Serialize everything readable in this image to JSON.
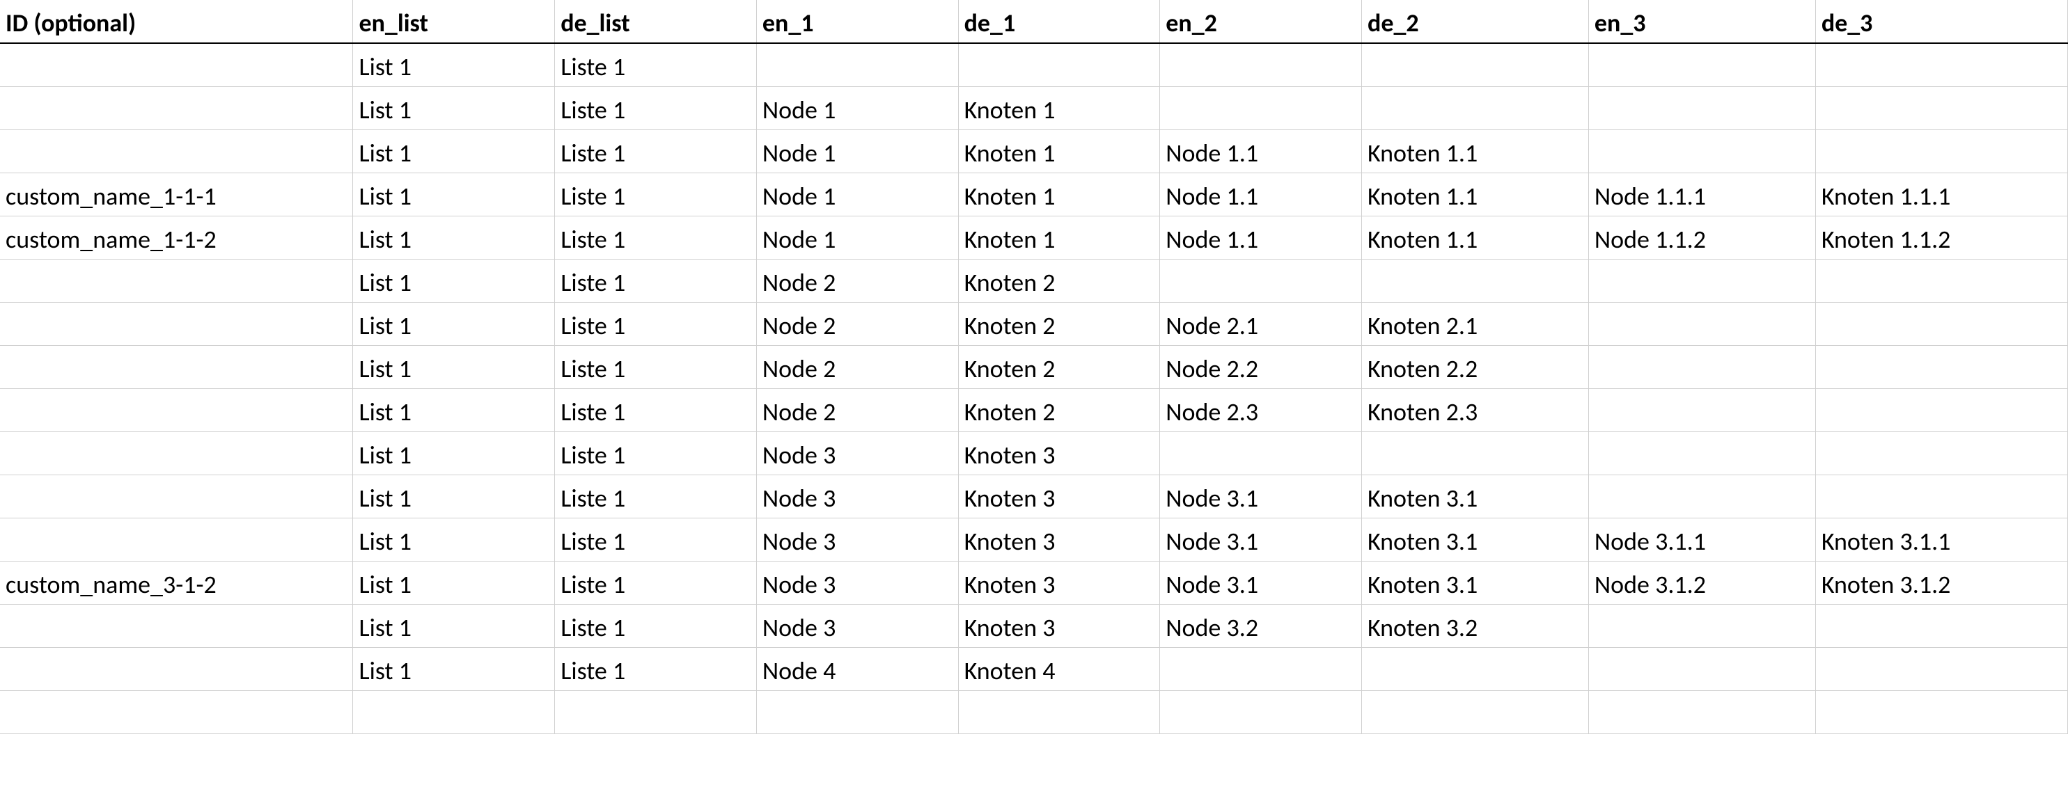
{
  "columns": [
    "ID (optional)",
    "en_list",
    "de_list",
    "en_1",
    "de_1",
    "en_2",
    "de_2",
    "en_3",
    "de_3"
  ],
  "rows": [
    [
      "",
      "List 1",
      "Liste 1",
      "",
      "",
      "",
      "",
      "",
      ""
    ],
    [
      "",
      "List 1",
      "Liste 1",
      "Node 1",
      "Knoten 1",
      "",
      "",
      "",
      ""
    ],
    [
      "",
      "List 1",
      "Liste 1",
      "Node 1",
      "Knoten 1",
      "Node 1.1",
      "Knoten 1.1",
      "",
      ""
    ],
    [
      "custom_name_1-1-1",
      "List 1",
      "Liste 1",
      "Node 1",
      "Knoten 1",
      "Node 1.1",
      "Knoten 1.1",
      "Node 1.1.1",
      "Knoten 1.1.1"
    ],
    [
      "custom_name_1-1-2",
      "List 1",
      "Liste 1",
      "Node 1",
      "Knoten 1",
      "Node 1.1",
      "Knoten 1.1",
      "Node 1.1.2",
      "Knoten 1.1.2"
    ],
    [
      "",
      "List 1",
      "Liste 1",
      "Node 2",
      "Knoten 2",
      "",
      "",
      "",
      ""
    ],
    [
      "",
      "List 1",
      "Liste 1",
      "Node 2",
      "Knoten 2",
      "Node 2.1",
      "Knoten 2.1",
      "",
      ""
    ],
    [
      "",
      "List 1",
      "Liste 1",
      "Node 2",
      "Knoten 2",
      "Node 2.2",
      "Knoten 2.2",
      "",
      ""
    ],
    [
      "",
      "List 1",
      "Liste 1",
      "Node 2",
      "Knoten 2",
      "Node 2.3",
      "Knoten 2.3",
      "",
      ""
    ],
    [
      "",
      "List 1",
      "Liste 1",
      "Node 3",
      "Knoten 3",
      "",
      "",
      "",
      ""
    ],
    [
      "",
      "List 1",
      "Liste 1",
      "Node 3",
      "Knoten 3",
      "Node 3.1",
      "Knoten 3.1",
      "",
      ""
    ],
    [
      "",
      "List 1",
      "Liste 1",
      "Node 3",
      "Knoten 3",
      "Node 3.1",
      "Knoten 3.1",
      "Node 3.1.1",
      "Knoten 3.1.1"
    ],
    [
      "custom_name_3-1-2",
      "List 1",
      "Liste 1",
      "Node 3",
      "Knoten 3",
      "Node 3.1",
      "Knoten 3.1",
      "Node 3.1.2",
      "Knoten 3.1.2"
    ],
    [
      "",
      "List 1",
      "Liste 1",
      "Node 3",
      "Knoten 3",
      "Node 3.2",
      "Knoten 3.2",
      "",
      ""
    ],
    [
      "",
      "List 1",
      "Liste 1",
      "Node 4",
      "Knoten 4",
      "",
      "",
      "",
      ""
    ],
    [
      "",
      "",
      "",
      "",
      "",
      "",
      "",
      "",
      ""
    ]
  ]
}
